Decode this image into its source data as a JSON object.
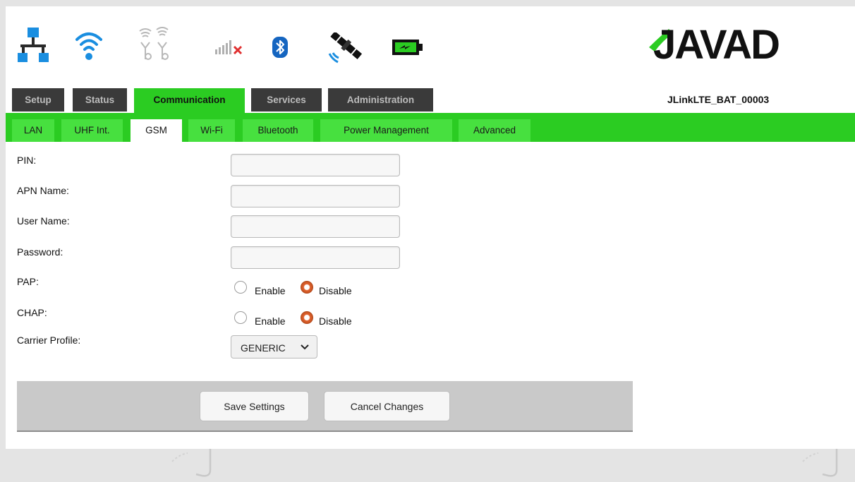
{
  "header": {
    "brand": "JAVAD",
    "device_name": "JLinkLTE_BAT_00003",
    "status_icons": [
      "lan-network-icon",
      "wifi-icon",
      "uhf-antenna-icon",
      "cellular-signal-no-service-icon",
      "bluetooth-icon",
      "satellite-icon",
      "battery-charging-icon"
    ],
    "colors": {
      "network_blue": "#1a8ee0",
      "battery_green": "#2bcc22",
      "no_signal_red": "#e03030"
    }
  },
  "main_tabs": [
    {
      "label": "Setup"
    },
    {
      "label": "Status"
    },
    {
      "label": "Communication",
      "active": true
    },
    {
      "label": "Services"
    },
    {
      "label": "Administration"
    }
  ],
  "sub_tabs": [
    {
      "label": "LAN"
    },
    {
      "label": "UHF Int."
    },
    {
      "label": "GSM",
      "active": true
    },
    {
      "label": "Wi-Fi"
    },
    {
      "label": "Bluetooth"
    },
    {
      "label": "Power Management"
    },
    {
      "label": "Advanced"
    }
  ],
  "form": {
    "pin_label": "PIN:",
    "pin_value": "",
    "apn_label": "APN Name:",
    "apn_value": "",
    "user_label": "User Name:",
    "user_value": "",
    "password_label": "Password:",
    "password_value": "",
    "pap_label": "PAP:",
    "pap_selected": "Disable",
    "chap_label": "CHAP:",
    "chap_selected": "Disable",
    "enable_label": "Enable",
    "disable_label": "Disable",
    "carrier_label": "Carrier Profile:",
    "carrier_value": "GENERIC"
  },
  "actions": {
    "save_label": "Save Settings",
    "cancel_label": "Cancel Changes"
  },
  "theme": {
    "accent_green": "#2bcc22",
    "tab_dark": "#3a3a3a",
    "radio_selected": "#d85a25"
  }
}
